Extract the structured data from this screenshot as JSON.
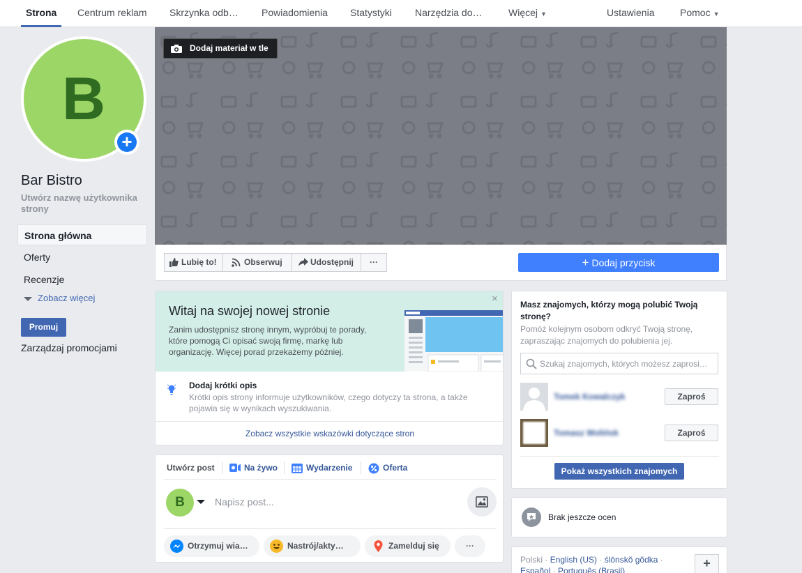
{
  "topnav": {
    "items": [
      {
        "label": "Strona",
        "active": true
      },
      {
        "label": "Centrum reklam"
      },
      {
        "label": "Skrzynka odb…"
      },
      {
        "label": "Powiadomienia"
      },
      {
        "label": "Statystyki"
      },
      {
        "label": "Narzędzia do…"
      },
      {
        "label": "Więcej"
      }
    ],
    "settings": "Ustawienia",
    "help": "Pomoc"
  },
  "profile": {
    "initial": "B",
    "page_name": "Bar Bistro",
    "username_prompt": "Utwórz nazwę użytkownika strony"
  },
  "leftnav": {
    "items": [
      "Strona główna",
      "Oferty",
      "Recenzje"
    ],
    "see_more": "Zobacz więcej",
    "promote": "Promuj",
    "manage_promotions": "Zarządzaj promocjami"
  },
  "cover": {
    "add_cover_label": "Dodaj materiał w tle",
    "background_color": "#7b7e87"
  },
  "actions": {
    "like": "Lubię to!",
    "follow": "Obserwuj",
    "share": "Udostępnij",
    "more": "···",
    "add_button": "Dodaj przycisk"
  },
  "welcome": {
    "title": "Witaj na swojej nowej stronie",
    "body": "Zanim udostępnisz stronę innym, wypróbuj te porady, które pomogą Ci opisać swoją firmę, markę lub organizację. Więcej porad przekażemy później.",
    "close": "×",
    "tip_title": "Dodaj krótki opis",
    "tip_body": "Krótki opis strony informuje użytkowników, czego dotyczy ta strona, a także pojawia się w wynikach wyszukiwania.",
    "all_tips_link": "Zobacz wszystkie wskazówki dotyczące stron"
  },
  "composer": {
    "tabs": [
      "Utwórz post",
      "Na żywo",
      "Wydarzenie",
      "Oferta"
    ],
    "avatar_initial": "B",
    "placeholder": "Napisz post...",
    "pills": [
      "Otrzymuj wia…",
      "Nastrój/akty…",
      "Zamelduj się",
      "···"
    ]
  },
  "friends": {
    "title": "Masz znajomych, którzy mogą polubić Twoją stronę?",
    "description": "Pomóż kolejnym osobom odkryć Twoją stronę, zapraszając znajomych do polubienia jej.",
    "search_placeholder": "Szukaj znajomych, których możesz zaprosi…",
    "list": [
      {
        "name": "Tomek Kowalczyk"
      },
      {
        "name": "Tomasz Wolińsk"
      }
    ],
    "invite_label": "Zaproś",
    "show_all": "Pokaż wszystkich znajomych"
  },
  "reviews": {
    "text": "Brak jeszcze ocen"
  },
  "languages": {
    "current": "Polski",
    "links": [
      "English (US)",
      "ślōnskŏ gŏdka",
      "Español",
      "Português (Brasil)"
    ],
    "plus": "+"
  },
  "colors": {
    "accent": "#4267b2",
    "primary_button": "#4080ff",
    "profile_green": "#9cd667"
  }
}
